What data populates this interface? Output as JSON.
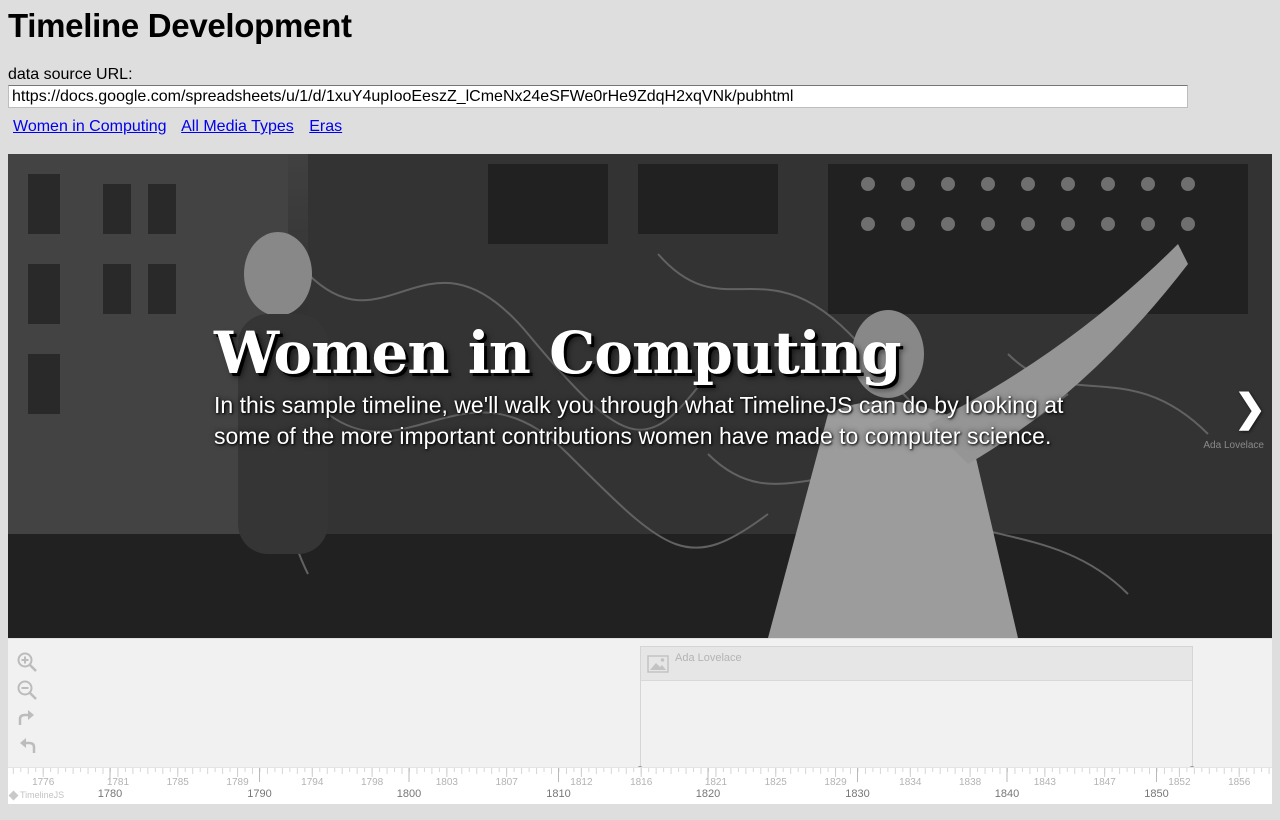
{
  "page": {
    "title": "Timeline Development",
    "source_label": "data source URL:",
    "source_url": "https://docs.google.com/spreadsheets/u/1/d/1xuY4upIooEeszZ_lCmeNx24eSFWe0rHe9ZdqH2xqVNk/pubhtml"
  },
  "links": [
    "Women in Computing",
    "All Media Types",
    "Eras"
  ],
  "slide": {
    "headline": "Women in Computing",
    "text": "In this sample timeline, we'll walk you through what TimelineJS can do by looking at some of the more important contributions women have made to computer science.",
    "next_arrow": "❯",
    "next_caption": "Ada Lovelace"
  },
  "nav": {
    "zoom_controls": [
      "zoom-in-icon",
      "zoom-out-icon",
      "forward-icon",
      "back-icon"
    ],
    "marker": {
      "title": "Ada Lovelace",
      "thumb_icon": "image-icon"
    },
    "brand": "TimelineJS",
    "minor_years": [
      "1776",
      "1781",
      "1785",
      "1789",
      "1794",
      "1798",
      "1803",
      "1807",
      "1812",
      "1816",
      "1821",
      "1825",
      "1829",
      "1834",
      "1838",
      "1843",
      "1847",
      "1852",
      "1856"
    ],
    "major_years": [
      "1780",
      "1790",
      "1800",
      "1810",
      "1820",
      "1830",
      "1840",
      "1850"
    ]
  }
}
